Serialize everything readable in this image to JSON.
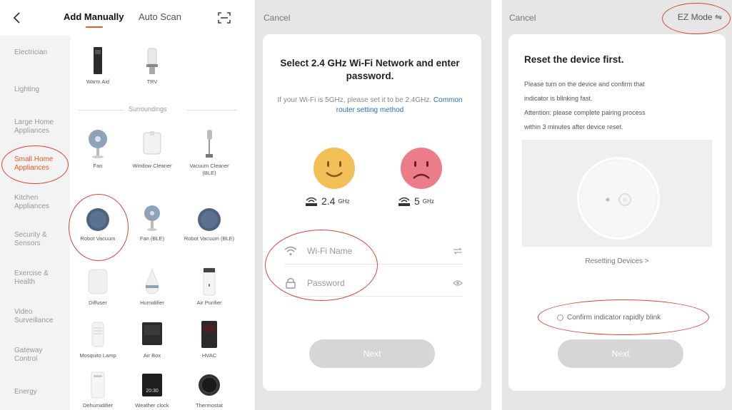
{
  "panel1": {
    "tabs": [
      {
        "label": "Add Manually",
        "active": true
      },
      {
        "label": "Auto Scan",
        "active": false
      }
    ],
    "categories": [
      {
        "label": "Electrician",
        "active": false
      },
      {
        "label": "Lighting",
        "active": false
      },
      {
        "label": "Large Home Appliances",
        "active": false
      },
      {
        "label": "Small Home Appliances",
        "active": true
      },
      {
        "label": "Kitchen Appliances",
        "active": false
      },
      {
        "label": "Security & Sensors",
        "active": false
      },
      {
        "label": "Exercise & Health",
        "active": false
      },
      {
        "label": "Video Surveillance",
        "active": false
      },
      {
        "label": "Gateway Control",
        "active": false
      },
      {
        "label": "Energy",
        "active": false
      }
    ],
    "section_label": "Surroundings",
    "devices": [
      {
        "label": "Warm Aid",
        "icon": "warm-aid-icon"
      },
      {
        "label": "TRV",
        "icon": "trv-icon"
      },
      {
        "label": "Fan",
        "icon": "fan-icon"
      },
      {
        "label": "Window Cleaner",
        "icon": "window-cleaner-icon"
      },
      {
        "label": "Vacuum Cleaner (BLE)",
        "icon": "vacuum-cleaner-icon"
      },
      {
        "label": "Robot Vacuum",
        "icon": "robot-vacuum-icon"
      },
      {
        "label": "Fan (BLE)",
        "icon": "fan-icon"
      },
      {
        "label": "Robot Vacuum (BLE)",
        "icon": "robot-vacuum-icon"
      },
      {
        "label": "Diffuser",
        "icon": "diffuser-icon"
      },
      {
        "label": "Humidifier",
        "icon": "humidifier-icon"
      },
      {
        "label": "Air Purifier",
        "icon": "air-purifier-icon"
      },
      {
        "label": "Mosquito Lamp",
        "icon": "mosquito-lamp-icon"
      },
      {
        "label": "Air Box",
        "icon": "air-box-icon"
      },
      {
        "label": "HVAC",
        "icon": "hvac-icon"
      },
      {
        "label": "Dehumidifier",
        "icon": "dehumidifier-icon"
      },
      {
        "label": "Weather clock",
        "icon": "weather-clock-icon"
      },
      {
        "label": "Thermostat",
        "icon": "thermostat-icon"
      }
    ],
    "clock_time": "20:30",
    "accent_color": "#e55a2b"
  },
  "panel2": {
    "cancel_label": "Cancel",
    "title": "Select 2.4 GHz Wi-Fi Network and enter password.",
    "subtitle": "If your Wi-Fi is 5GHz, please set it to be 2.4GHz.",
    "link": "Common router setting method",
    "band_24": {
      "value": "2.4",
      "unit": "GHz"
    },
    "band_5": {
      "value": "5",
      "unit": "GHz"
    },
    "wifi_placeholder": "Wi-Fi Name",
    "password_placeholder": "Password",
    "next_label": "Next"
  },
  "panel3": {
    "cancel_label": "Cancel",
    "ez_mode_label": "EZ Mode",
    "title": "Reset the device first.",
    "body_lines": [
      "Please turn on the device and confirm that",
      "indicator is blinking fast.",
      "Attention: please complete pairing process",
      "within 3 minutes after device reset."
    ],
    "resetting_link": "Resetting Devices >",
    "confirm_label": "Confirm indicator rapidly blink",
    "next_label": "Next"
  }
}
